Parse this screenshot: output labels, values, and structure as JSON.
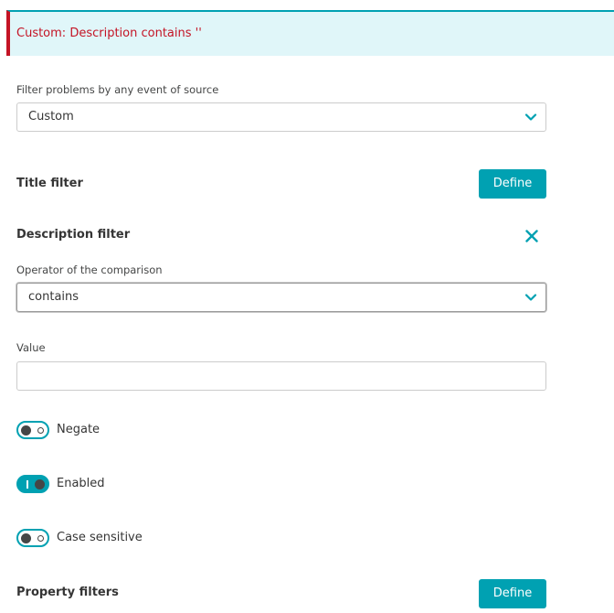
{
  "banner": {
    "text": "Custom: Description contains ''"
  },
  "source_filter": {
    "label": "Filter problems by any event of source",
    "value": "Custom"
  },
  "title_filter": {
    "label": "Title filter",
    "button": "Define"
  },
  "description_filter": {
    "label": "Description filter",
    "operator_label": "Operator of the comparison",
    "operator_value": "contains",
    "value_label": "Value",
    "value": ""
  },
  "toggles": {
    "negate": {
      "label": "Negate",
      "on": false
    },
    "enabled": {
      "label": "Enabled",
      "on": true
    },
    "case_sensitive": {
      "label": "Case sensitive",
      "on": false
    }
  },
  "property_filters": {
    "label": "Property filters",
    "button": "Define"
  },
  "colors": {
    "accent": "#00a1b2",
    "error": "#c41425",
    "banner_bg": "#e0f6f9"
  }
}
